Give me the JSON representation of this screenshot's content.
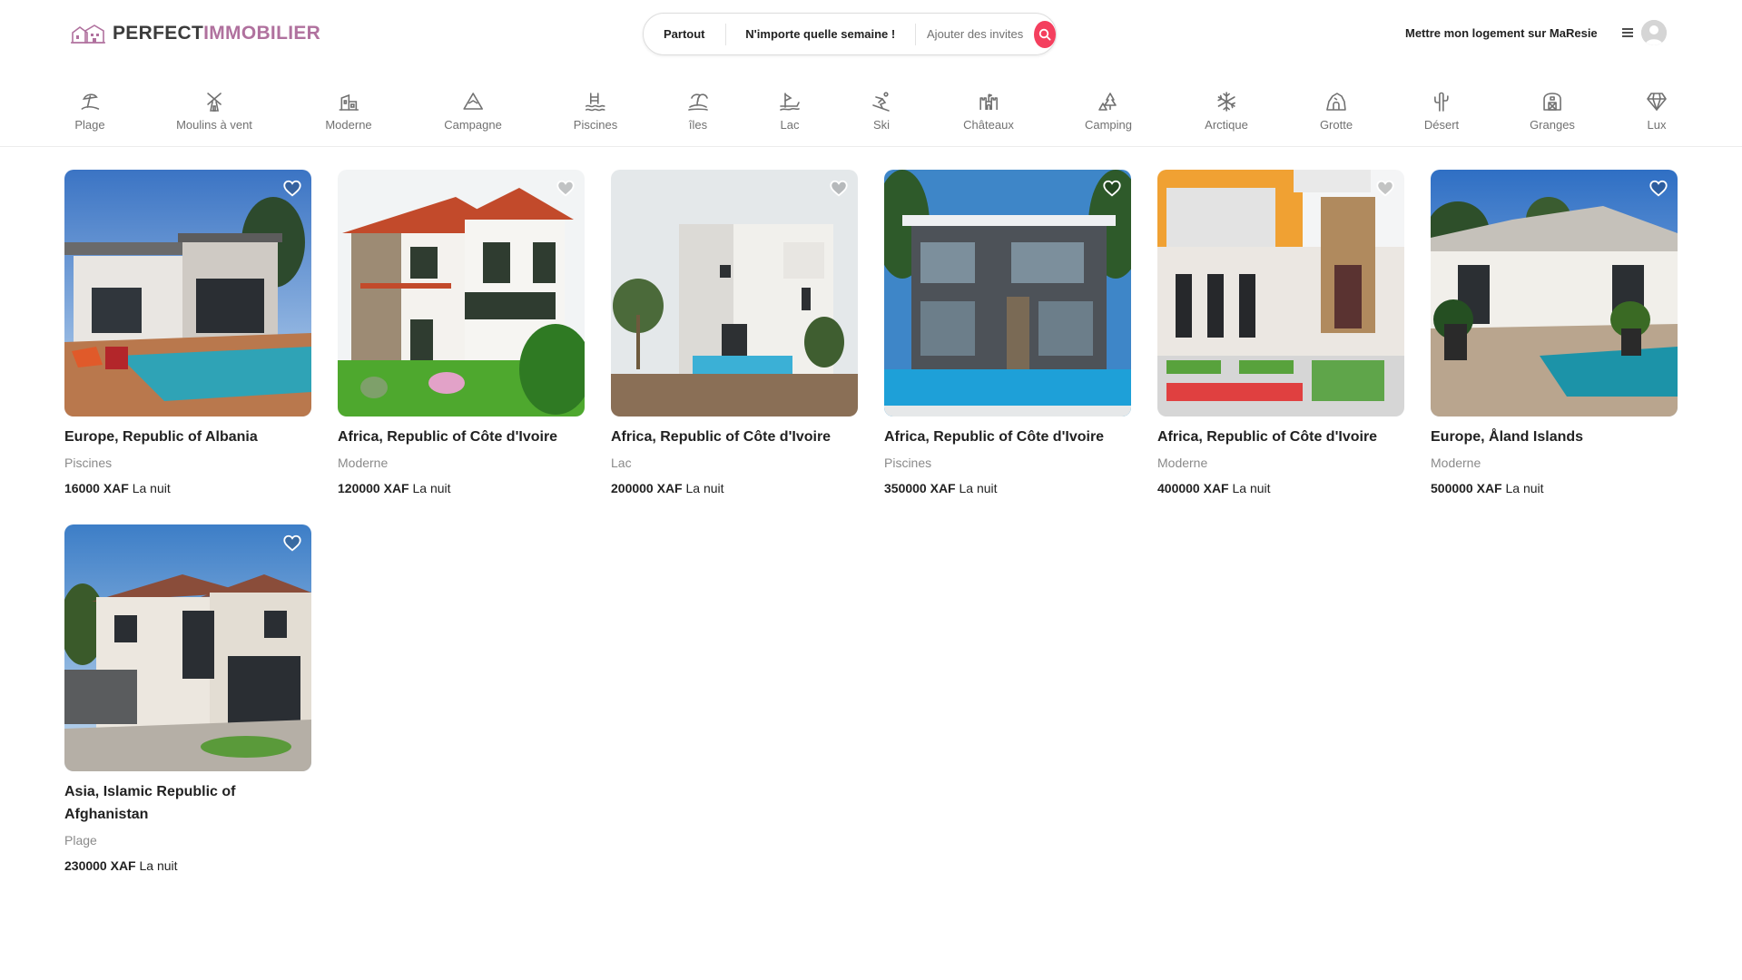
{
  "brand": {
    "part1": "PERFECT",
    "part2": "IMMOBILIER",
    "accent_color": "#b0719e"
  },
  "search": {
    "where": "Partout",
    "when": "N'importe quelle semaine !",
    "guests": "Ajouter des invites",
    "button_color": "#f43f5e"
  },
  "header": {
    "host_link": "Mettre mon logement sur MaResie"
  },
  "categories": [
    {
      "label": "Plage",
      "icon": "beach-icon"
    },
    {
      "label": "Moulins à vent",
      "icon": "windmill-icon"
    },
    {
      "label": "Moderne",
      "icon": "modern-house-icon"
    },
    {
      "label": "Campagne",
      "icon": "mountain-icon"
    },
    {
      "label": "Piscines",
      "icon": "pool-icon"
    },
    {
      "label": "îles",
      "icon": "island-icon"
    },
    {
      "label": "Lac",
      "icon": "lake-icon"
    },
    {
      "label": "Ski",
      "icon": "skiing-icon"
    },
    {
      "label": "Châteaux",
      "icon": "castle-icon"
    },
    {
      "label": "Camping",
      "icon": "camping-icon"
    },
    {
      "label": "Arctique",
      "icon": "snowflake-icon"
    },
    {
      "label": "Grotte",
      "icon": "cave-icon"
    },
    {
      "label": "Désert",
      "icon": "cactus-icon"
    },
    {
      "label": "Granges",
      "icon": "barn-icon"
    },
    {
      "label": "Lux",
      "icon": "diamond-icon"
    }
  ],
  "listings": [
    {
      "title": "Europe, Republic of Albania",
      "category": "Piscines",
      "price": "16000 XAF",
      "price_suffix": "La nuit"
    },
    {
      "title": "Africa, Republic of Côte d'Ivoire",
      "category": "Moderne",
      "price": "120000 XAF",
      "price_suffix": "La nuit"
    },
    {
      "title": "Africa, Republic of Côte d'Ivoire",
      "category": "Lac",
      "price": "200000 XAF",
      "price_suffix": "La nuit"
    },
    {
      "title": "Africa, Republic of Côte d'Ivoire",
      "category": "Piscines",
      "price": "350000 XAF",
      "price_suffix": "La nuit"
    },
    {
      "title": "Africa, Republic of Côte d'Ivoire",
      "category": "Moderne",
      "price": "400000 XAF",
      "price_suffix": "La nuit"
    },
    {
      "title": "Europe, Åland Islands",
      "category": "Moderne",
      "price": "500000 XAF",
      "price_suffix": "La nuit"
    },
    {
      "title": "Asia, Islamic Republic of Afghanistan",
      "category": "Plage",
      "price": "230000 XAF",
      "price_suffix": "La nuit"
    }
  ]
}
